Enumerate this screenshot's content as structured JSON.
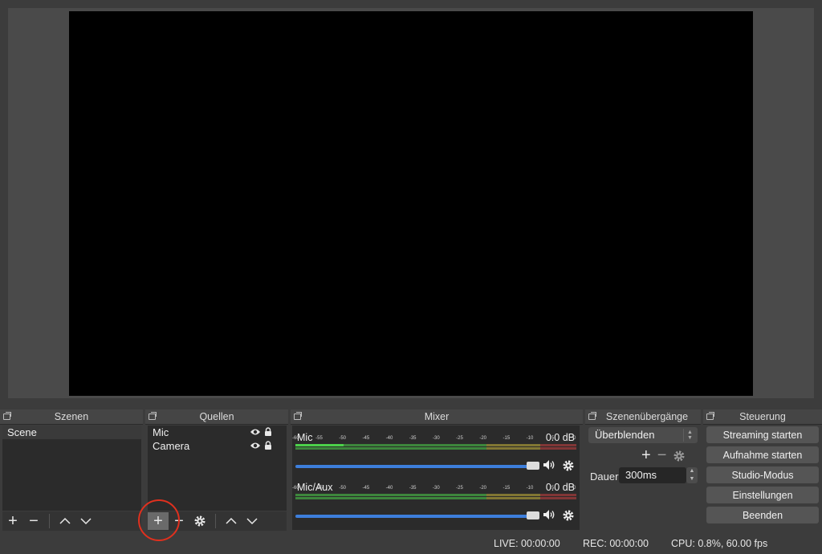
{
  "docks": {
    "scenes": {
      "title": "Szenen",
      "items": [
        "Scene"
      ]
    },
    "sources": {
      "title": "Quellen",
      "items": [
        "Mic",
        "Camera"
      ]
    },
    "mixer": {
      "title": "Mixer",
      "ticks": [
        "-60",
        "-55",
        "-50",
        "-45",
        "-40",
        "-35",
        "-30",
        "-25",
        "-20",
        "-15",
        "-10",
        "-5",
        "0"
      ],
      "channels": [
        {
          "name": "Mic",
          "db": "0.0 dB",
          "level": 0.92
        },
        {
          "name": "Mic/Aux",
          "db": "0.0 dB",
          "level": 0.92
        }
      ]
    },
    "transitions": {
      "title": "Szenenübergänge",
      "selected": "Überblenden",
      "duration_label": "Dauer",
      "duration_value": "300ms"
    },
    "controls": {
      "title": "Steuerung",
      "buttons": [
        "Streaming starten",
        "Aufnahme starten",
        "Studio-Modus",
        "Einstellungen",
        "Beenden"
      ]
    }
  },
  "status": {
    "live": "LIVE: 00:00:00",
    "rec": "REC: 00:00:00",
    "cpu": "CPU: 0.8%, 60.00 fps"
  },
  "colors": {
    "accent": "#3d7edb",
    "meter_green": "#4cd14a",
    "meter_yellow": "#c8b43a",
    "meter_red": "#c84040",
    "highlight": "#e0301e"
  }
}
